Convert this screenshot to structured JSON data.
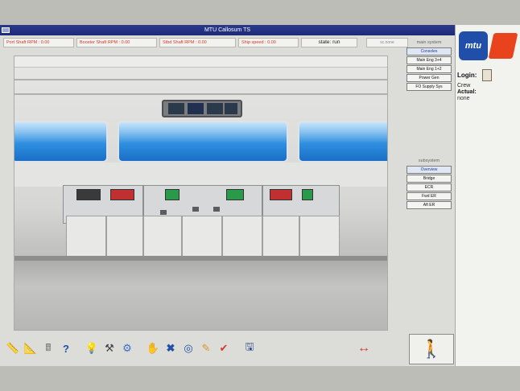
{
  "window": {
    "title": "MTU Callosum TS"
  },
  "statusbar": {
    "fields": [
      "Port Shaft RPM : 0.00",
      "Booster Shaft RPM : 0.00",
      "Stbd Shaft RPM : 0.00",
      "Ship speed : 0.00"
    ],
    "state": "state: run",
    "right_small": "sc.none"
  },
  "menu": {
    "main_heading": "main system",
    "main_items": [
      "Consoles",
      "Main Eng 3+4",
      "Main Eng 1+2",
      "Power Gen",
      "FO Supply Sys"
    ],
    "sub_heading": "subsystem",
    "sub_items": [
      "Overview",
      "Bridge",
      "ECR",
      "Fwd ER",
      "Aft ER"
    ]
  },
  "sidepanel": {
    "logo_text": "mtu",
    "login_label": "Login:",
    "crew_label": "Crew",
    "actual_label": "Actual:",
    "actual_value": "none"
  },
  "colors": {
    "titlebar": "#1c2a78",
    "status_text": "#d43a2a",
    "brand_blue": "#1f4fa8",
    "brand_red": "#e8431c",
    "window_sky": "#2f8fe0"
  },
  "toolbar_icons": [
    "ruler-icon",
    "ruler2-icon",
    "calculator-icon",
    "help-icon",
    "bulb-icon",
    "tools-icon",
    "gear-icon",
    "hand-icon",
    "cancel-icon",
    "target-icon",
    "edit-icon",
    "check-icon",
    "save-icon",
    "connect-icon",
    "exit-icon"
  ]
}
